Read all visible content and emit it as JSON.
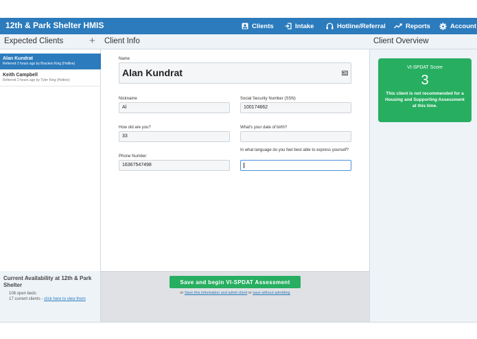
{
  "app": {
    "title": "12th & Park Shelter HMIS",
    "nav": [
      {
        "label": "Clients",
        "icon": "person-card-icon"
      },
      {
        "label": "Intake",
        "icon": "sign-in-icon"
      },
      {
        "label": "Hotline/Referral",
        "icon": "headphones-icon"
      },
      {
        "label": "Reports",
        "icon": "trend-line-icon"
      },
      {
        "label": "Account",
        "icon": "gear-icon"
      }
    ]
  },
  "sidebar": {
    "title": "Expected Clients",
    "add_label": "+",
    "clients": [
      {
        "name": "Alan Kundrat",
        "sub": "Referred 2 hours ago by Bracken King (Hotline)"
      },
      {
        "name": "Keith Campbell",
        "sub": "Referred 2 hours ago by Tyler King (Hotline)"
      }
    ],
    "availability": {
      "title": "Current Availability at 12th & Park Shelter",
      "beds": "108 open beds",
      "clients_prefix": "17 current clients - ",
      "clients_link": "click here to view them"
    }
  },
  "main": {
    "title": "Client Info",
    "name_label": "Name",
    "name_value": "Alan  Kundrat",
    "fields": {
      "nickname": {
        "label": "Nickname",
        "value": "Al"
      },
      "ssn": {
        "label": "Social Security Number (SSN)",
        "value": "100174662"
      },
      "age": {
        "label": "How old are you?",
        "value": "33"
      },
      "dob": {
        "label": "What's your date of birth?",
        "value": ""
      },
      "phone": {
        "label": "Phone Number",
        "value": "16367547498"
      },
      "language": {
        "label": "In what language do you feel best able to express yourself?",
        "value": ""
      }
    },
    "save_button": "Save and begin VI-SPDAT Assessment",
    "or1": "or ",
    "save_admit_link": "Save this information and admit client",
    "or2": " or ",
    "save_without_link": "save without admitting"
  },
  "overview": {
    "title": "Client Overview",
    "score_title": "VI-SPDAT Score",
    "score_value": "3",
    "score_message": "This client is not recommended for a Housing and Supporting Assessment at this time."
  },
  "colors": {
    "primary": "#2b7bbd",
    "success": "#27ae60",
    "panel": "#eef3f8"
  }
}
